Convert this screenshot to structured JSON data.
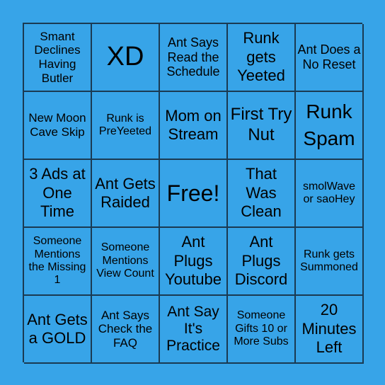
{
  "board": {
    "background_color": "#37a4e8",
    "grid_color": "#1a3a52",
    "cells": [
      "Smant Declines Having Butler",
      "XD",
      "Ant Says Read the Schedule",
      "Runk gets Yeeted",
      "Ant Does a No Reset",
      "New Moon Cave Skip",
      "Runk is PreYeeted",
      "Mom on Stream",
      "First Try Nut",
      "Runk Spam",
      "3 Ads at One Time",
      "Ant Gets Raided",
      "Free!",
      "That Was Clean",
      "smolWave or saoHey",
      "Someone Mentions the Missing 1",
      "Someone Mentions View Count",
      "Ant Plugs Youtube",
      "Ant Plugs Discord",
      "Runk gets Summoned",
      "Ant Gets a GOLD",
      "Ant Says Check the FAQ",
      "Ant Say It's Practice",
      "Someone Gifts 10 or More Subs",
      "20 Minutes Left"
    ]
  }
}
